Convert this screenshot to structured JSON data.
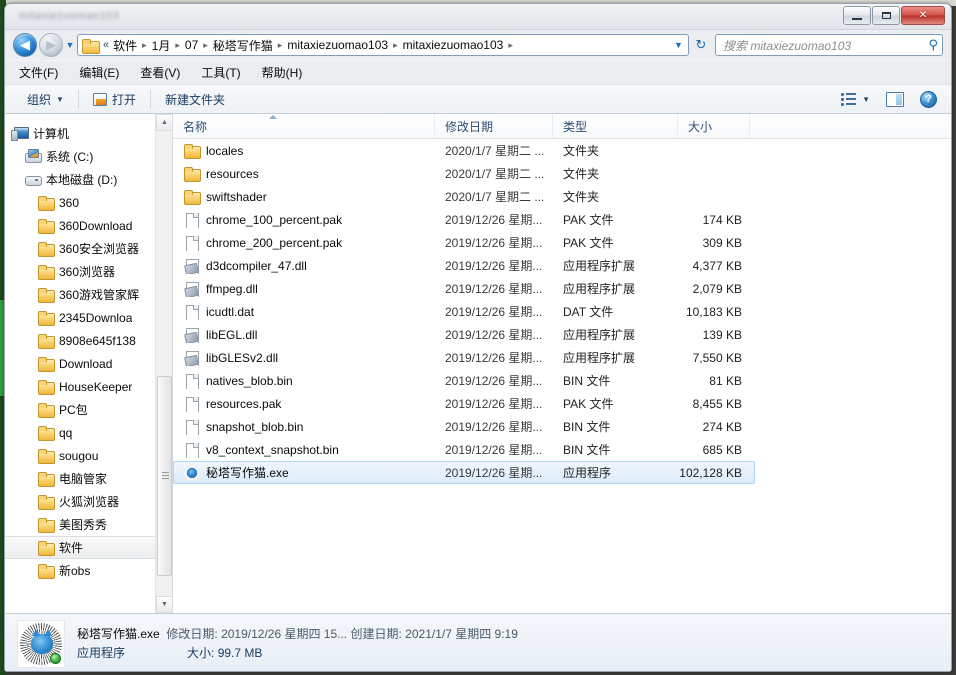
{
  "window": {
    "title": "mitaxiezuomao103",
    "controls": {
      "minimize": "–",
      "maximize": "□",
      "close": "✕"
    }
  },
  "address_bar": {
    "back": "◀",
    "forward": "▶",
    "recent_dropdown": "▼",
    "overflow": "«",
    "crumbs": [
      "软件",
      "1月",
      "07",
      "秘塔写作猫",
      "mitaxiezuomao103",
      "mitaxiezuomao103"
    ],
    "separator": "▸",
    "dropdown": "▼",
    "refresh": "↻"
  },
  "search": {
    "placeholder": "搜索 mitaxiezuomao103",
    "icon": "search-icon"
  },
  "menubar": {
    "items": [
      {
        "text": "文件(F)",
        "label": "文件",
        "accel": "F"
      },
      {
        "text": "编辑(E)",
        "label": "编辑",
        "accel": "E"
      },
      {
        "text": "查看(V)",
        "label": "查看",
        "accel": "V"
      },
      {
        "text": "工具(T)",
        "label": "工具",
        "accel": "T"
      },
      {
        "text": "帮助(H)",
        "label": "帮助",
        "accel": "H"
      }
    ]
  },
  "toolbar": {
    "organize": "组织",
    "organize_caret": "▼",
    "open": "打开",
    "new_folder": "新建文件夹",
    "view_caret": "▼",
    "help": "?"
  },
  "sidebar": {
    "items": [
      {
        "label": "计算机",
        "icon": "computer-icon",
        "indent": 0,
        "selected": false
      },
      {
        "label": "系统 (C:)",
        "icon": "system-drive-icon",
        "indent": 1,
        "selected": false
      },
      {
        "label": "本地磁盘 (D:)",
        "icon": "drive-icon",
        "indent": 1,
        "selected": false
      },
      {
        "label": "360",
        "icon": "folder-icon",
        "indent": 2,
        "selected": false
      },
      {
        "label": "360Download",
        "icon": "folder-icon",
        "indent": 2,
        "selected": false
      },
      {
        "label": "360安全浏览器",
        "icon": "folder-icon",
        "indent": 2,
        "selected": false
      },
      {
        "label": "360浏览器",
        "icon": "folder-icon",
        "indent": 2,
        "selected": false
      },
      {
        "label": "360游戏管家辉",
        "icon": "folder-icon",
        "indent": 2,
        "selected": false
      },
      {
        "label": "2345Downloa",
        "icon": "folder-icon",
        "indent": 2,
        "selected": false
      },
      {
        "label": "8908e645f138",
        "icon": "folder-icon",
        "indent": 2,
        "selected": false
      },
      {
        "label": "Download",
        "icon": "folder-icon",
        "indent": 2,
        "selected": false
      },
      {
        "label": "HouseKeeper",
        "icon": "folder-icon",
        "indent": 2,
        "selected": false
      },
      {
        "label": "PC包",
        "icon": "folder-icon",
        "indent": 2,
        "selected": false
      },
      {
        "label": "qq",
        "icon": "folder-icon",
        "indent": 2,
        "selected": false
      },
      {
        "label": "sougou",
        "icon": "folder-icon",
        "indent": 2,
        "selected": false
      },
      {
        "label": "电脑管家",
        "icon": "folder-icon",
        "indent": 2,
        "selected": false
      },
      {
        "label": "火狐浏览器",
        "icon": "folder-icon",
        "indent": 2,
        "selected": false
      },
      {
        "label": "美图秀秀",
        "icon": "folder-icon",
        "indent": 2,
        "selected": false
      },
      {
        "label": "软件",
        "icon": "folder-icon",
        "indent": 2,
        "selected": true
      },
      {
        "label": "新obs",
        "icon": "folder-icon",
        "indent": 2,
        "selected": false
      }
    ],
    "scroll_up": "▲",
    "scroll_down": "▼"
  },
  "filelist": {
    "columns": [
      {
        "key": "name",
        "label": "名称",
        "sorted": true
      },
      {
        "key": "date",
        "label": "修改日期",
        "sorted": false
      },
      {
        "key": "type",
        "label": "类型",
        "sorted": false
      },
      {
        "key": "size",
        "label": "大小",
        "sorted": false
      }
    ],
    "rows": [
      {
        "name": "locales",
        "date": "2020/1/7 星期二 ...",
        "type": "文件夹",
        "size": "",
        "icon": "folder-icon",
        "selected": false
      },
      {
        "name": "resources",
        "date": "2020/1/7 星期二 ...",
        "type": "文件夹",
        "size": "",
        "icon": "folder-icon",
        "selected": false
      },
      {
        "name": "swiftshader",
        "date": "2020/1/7 星期二 ...",
        "type": "文件夹",
        "size": "",
        "icon": "folder-icon",
        "selected": false
      },
      {
        "name": "chrome_100_percent.pak",
        "date": "2019/12/26 星期...",
        "type": "PAK 文件",
        "size": "174 KB",
        "icon": "file-icon",
        "selected": false
      },
      {
        "name": "chrome_200_percent.pak",
        "date": "2019/12/26 星期...",
        "type": "PAK 文件",
        "size": "309 KB",
        "icon": "file-icon",
        "selected": false
      },
      {
        "name": "d3dcompiler_47.dll",
        "date": "2019/12/26 星期...",
        "type": "应用程序扩展",
        "size": "4,377 KB",
        "icon": "dll-icon",
        "selected": false
      },
      {
        "name": "ffmpeg.dll",
        "date": "2019/12/26 星期...",
        "type": "应用程序扩展",
        "size": "2,079 KB",
        "icon": "dll-icon",
        "selected": false
      },
      {
        "name": "icudtl.dat",
        "date": "2019/12/26 星期...",
        "type": "DAT 文件",
        "size": "10,183 KB",
        "icon": "file-icon",
        "selected": false
      },
      {
        "name": "libEGL.dll",
        "date": "2019/12/26 星期...",
        "type": "应用程序扩展",
        "size": "139 KB",
        "icon": "dll-icon",
        "selected": false
      },
      {
        "name": "libGLESv2.dll",
        "date": "2019/12/26 星期...",
        "type": "应用程序扩展",
        "size": "7,550 KB",
        "icon": "dll-icon",
        "selected": false
      },
      {
        "name": "natives_blob.bin",
        "date": "2019/12/26 星期...",
        "type": "BIN 文件",
        "size": "81 KB",
        "icon": "file-icon",
        "selected": false
      },
      {
        "name": "resources.pak",
        "date": "2019/12/26 星期...",
        "type": "PAK 文件",
        "size": "8,455 KB",
        "icon": "file-icon",
        "selected": false
      },
      {
        "name": "snapshot_blob.bin",
        "date": "2019/12/26 星期...",
        "type": "BIN 文件",
        "size": "274 KB",
        "icon": "file-icon",
        "selected": false
      },
      {
        "name": "v8_context_snapshot.bin",
        "date": "2019/12/26 星期...",
        "type": "BIN 文件",
        "size": "685 KB",
        "icon": "file-icon",
        "selected": false
      },
      {
        "name": "秘塔写作猫.exe",
        "date": "2019/12/26 星期...",
        "type": "应用程序",
        "size": "102,128 KB",
        "icon": "app-icon",
        "selected": true
      }
    ]
  },
  "details": {
    "file_name": "秘塔写作猫.exe",
    "modified_label": "修改日期:",
    "modified_value": "2019/12/26 星期四 15...",
    "created_label": "创建日期:",
    "created_value": "2021/1/7 星期四 9:19",
    "type_value": "应用程序",
    "size_label": "大小:",
    "size_value": "99.7 MB"
  }
}
